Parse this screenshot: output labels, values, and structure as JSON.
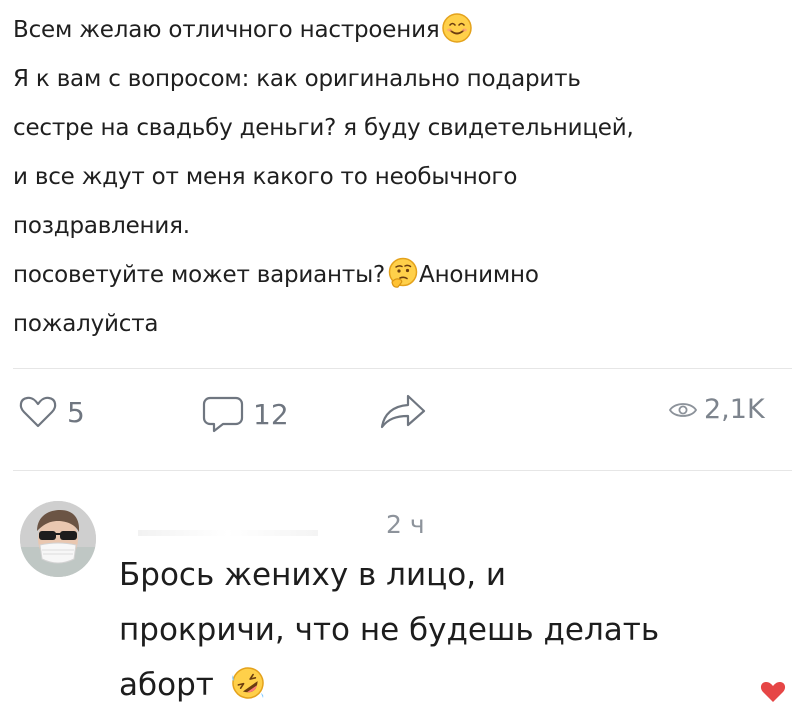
{
  "post": {
    "lines": [
      "Всем желаю отличного настроения",
      "Я к вам с вопросом: как оригинально подарить",
      "сестре на свадьбу деньги? я буду свидетельницей,",
      "и все ждут от меня какого то необычного",
      "поздравления.",
      "посоветуйте может варианты?",
      "пожалуйста"
    ],
    "line6_suffix": "Анонимно",
    "emojis": [
      "smiling-face-emoji",
      "thinking-face-emoji"
    ]
  },
  "actions": {
    "likes": "5",
    "comments": "12",
    "views": "2,1K",
    "icons": [
      "heart-icon",
      "comment-icon",
      "share-icon",
      "eye-icon"
    ]
  },
  "comment": {
    "time": "2 ч",
    "lines": [
      "Брось жениху в лицо, и",
      "прокричи, что не будешь делать",
      "аборт"
    ],
    "emoji": "rolling-on-floor-laughing-emoji",
    "liked_icon": "heart-filled-icon",
    "colors": {
      "liked": "#e64646",
      "muted": "#6f7680"
    }
  }
}
